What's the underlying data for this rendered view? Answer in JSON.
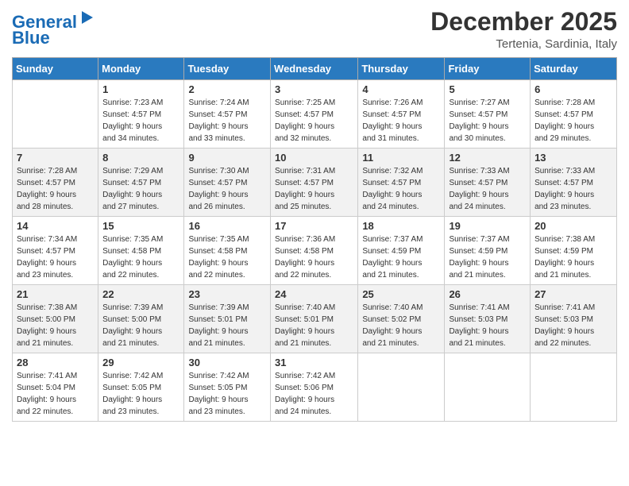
{
  "header": {
    "logo_line1": "General",
    "logo_line2": "Blue",
    "month": "December 2025",
    "location": "Tertenia, Sardinia, Italy"
  },
  "weekdays": [
    "Sunday",
    "Monday",
    "Tuesday",
    "Wednesday",
    "Thursday",
    "Friday",
    "Saturday"
  ],
  "weeks": [
    [
      {
        "day": "",
        "sunrise": "",
        "sunset": "",
        "daylight": ""
      },
      {
        "day": "1",
        "sunrise": "7:23 AM",
        "sunset": "4:57 PM",
        "hours": "9",
        "minutes": "34"
      },
      {
        "day": "2",
        "sunrise": "7:24 AM",
        "sunset": "4:57 PM",
        "hours": "9",
        "minutes": "33"
      },
      {
        "day": "3",
        "sunrise": "7:25 AM",
        "sunset": "4:57 PM",
        "hours": "9",
        "minutes": "32"
      },
      {
        "day": "4",
        "sunrise": "7:26 AM",
        "sunset": "4:57 PM",
        "hours": "9",
        "minutes": "31"
      },
      {
        "day": "5",
        "sunrise": "7:27 AM",
        "sunset": "4:57 PM",
        "hours": "9",
        "minutes": "30"
      },
      {
        "day": "6",
        "sunrise": "7:28 AM",
        "sunset": "4:57 PM",
        "hours": "9",
        "minutes": "29"
      }
    ],
    [
      {
        "day": "7",
        "sunrise": "7:28 AM",
        "sunset": "4:57 PM",
        "hours": "9",
        "minutes": "28"
      },
      {
        "day": "8",
        "sunrise": "7:29 AM",
        "sunset": "4:57 PM",
        "hours": "9",
        "minutes": "27"
      },
      {
        "day": "9",
        "sunrise": "7:30 AM",
        "sunset": "4:57 PM",
        "hours": "9",
        "minutes": "26"
      },
      {
        "day": "10",
        "sunrise": "7:31 AM",
        "sunset": "4:57 PM",
        "hours": "9",
        "minutes": "25"
      },
      {
        "day": "11",
        "sunrise": "7:32 AM",
        "sunset": "4:57 PM",
        "hours": "9",
        "minutes": "24"
      },
      {
        "day": "12",
        "sunrise": "7:33 AM",
        "sunset": "4:57 PM",
        "hours": "9",
        "minutes": "24"
      },
      {
        "day": "13",
        "sunrise": "7:33 AM",
        "sunset": "4:57 PM",
        "hours": "9",
        "minutes": "23"
      }
    ],
    [
      {
        "day": "14",
        "sunrise": "7:34 AM",
        "sunset": "4:57 PM",
        "hours": "9",
        "minutes": "23"
      },
      {
        "day": "15",
        "sunrise": "7:35 AM",
        "sunset": "4:58 PM",
        "hours": "9",
        "minutes": "22"
      },
      {
        "day": "16",
        "sunrise": "7:35 AM",
        "sunset": "4:58 PM",
        "hours": "9",
        "minutes": "22"
      },
      {
        "day": "17",
        "sunrise": "7:36 AM",
        "sunset": "4:58 PM",
        "hours": "9",
        "minutes": "22"
      },
      {
        "day": "18",
        "sunrise": "7:37 AM",
        "sunset": "4:59 PM",
        "hours": "9",
        "minutes": "21"
      },
      {
        "day": "19",
        "sunrise": "7:37 AM",
        "sunset": "4:59 PM",
        "hours": "9",
        "minutes": "21"
      },
      {
        "day": "20",
        "sunrise": "7:38 AM",
        "sunset": "4:59 PM",
        "hours": "9",
        "minutes": "21"
      }
    ],
    [
      {
        "day": "21",
        "sunrise": "7:38 AM",
        "sunset": "5:00 PM",
        "hours": "9",
        "minutes": "21"
      },
      {
        "day": "22",
        "sunrise": "7:39 AM",
        "sunset": "5:00 PM",
        "hours": "9",
        "minutes": "21"
      },
      {
        "day": "23",
        "sunrise": "7:39 AM",
        "sunset": "5:01 PM",
        "hours": "9",
        "minutes": "21"
      },
      {
        "day": "24",
        "sunrise": "7:40 AM",
        "sunset": "5:01 PM",
        "hours": "9",
        "minutes": "21"
      },
      {
        "day": "25",
        "sunrise": "7:40 AM",
        "sunset": "5:02 PM",
        "hours": "9",
        "minutes": "21"
      },
      {
        "day": "26",
        "sunrise": "7:41 AM",
        "sunset": "5:03 PM",
        "hours": "9",
        "minutes": "21"
      },
      {
        "day": "27",
        "sunrise": "7:41 AM",
        "sunset": "5:03 PM",
        "hours": "9",
        "minutes": "22"
      }
    ],
    [
      {
        "day": "28",
        "sunrise": "7:41 AM",
        "sunset": "5:04 PM",
        "hours": "9",
        "minutes": "22"
      },
      {
        "day": "29",
        "sunrise": "7:42 AM",
        "sunset": "5:05 PM",
        "hours": "9",
        "minutes": "23"
      },
      {
        "day": "30",
        "sunrise": "7:42 AM",
        "sunset": "5:05 PM",
        "hours": "9",
        "minutes": "23"
      },
      {
        "day": "31",
        "sunrise": "7:42 AM",
        "sunset": "5:06 PM",
        "hours": "9",
        "minutes": "24"
      },
      {
        "day": "",
        "sunrise": "",
        "sunset": "",
        "hours": "",
        "minutes": ""
      },
      {
        "day": "",
        "sunrise": "",
        "sunset": "",
        "hours": "",
        "minutes": ""
      },
      {
        "day": "",
        "sunrise": "",
        "sunset": "",
        "hours": "",
        "minutes": ""
      }
    ]
  ]
}
